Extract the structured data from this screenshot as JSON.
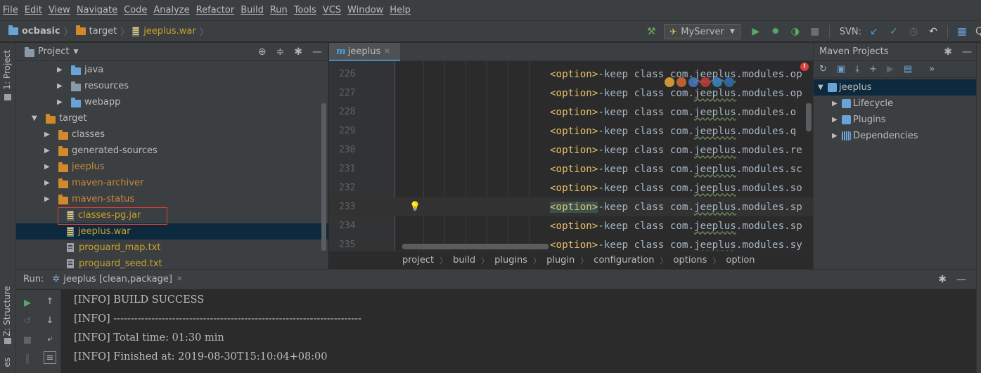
{
  "menu": [
    "File",
    "Edit",
    "View",
    "Navigate",
    "Code",
    "Analyze",
    "Refactor",
    "Build",
    "Run",
    "Tools",
    "VCS",
    "Window",
    "Help"
  ],
  "nav_breadcrumbs": [
    "ocbasic",
    "target",
    "jeeplus.war"
  ],
  "toolbar": {
    "run_config": "MyServer",
    "svn_label": "SVN:"
  },
  "left_tabs": {
    "project": "1: Project",
    "structure": "Z: Structure",
    "favorites": "es"
  },
  "project_panel": {
    "title": "Project",
    "tree": [
      {
        "label": "java",
        "arrow": "▶",
        "icon": "folder-blue",
        "color": "plain"
      },
      {
        "label": "resources",
        "arrow": "▶",
        "icon": "folder-gray",
        "color": "plain"
      },
      {
        "label": "webapp",
        "arrow": "▶",
        "icon": "folder-blue",
        "color": "plain"
      },
      {
        "label": "target",
        "arrow": "▼",
        "icon": "folder-orange",
        "color": "plain"
      },
      {
        "label": "classes",
        "arrow": "▶",
        "icon": "folder-orange",
        "color": "plain"
      },
      {
        "label": "generated-sources",
        "arrow": "▶",
        "icon": "folder-orange",
        "color": "plain"
      },
      {
        "label": "jeeplus",
        "arrow": "▶",
        "icon": "folder-orange",
        "color": "orange"
      },
      {
        "label": "maven-archiver",
        "arrow": "▶",
        "icon": "folder-orange",
        "color": "orange"
      },
      {
        "label": "maven-status",
        "arrow": "▶",
        "icon": "folder-orange",
        "color": "orange"
      },
      {
        "label": "classes-pg.jar",
        "arrow": "",
        "icon": "archive",
        "color": "yellow"
      },
      {
        "label": "jeeplus.war",
        "arrow": "",
        "icon": "archive",
        "color": "yellow"
      },
      {
        "label": "proguard_map.txt",
        "arrow": "",
        "icon": "text-file",
        "color": "yellow"
      },
      {
        "label": "proguard_seed.txt",
        "arrow": "",
        "icon": "text-file",
        "color": "yellow"
      }
    ]
  },
  "editor": {
    "tab_label": "jeeplus",
    "lines": [
      {
        "no": "226",
        "tag": "<option>",
        "text": "-keep class com.",
        "pkg": "jeeplus",
        "rest": ".modules.op"
      },
      {
        "no": "227",
        "tag": "<option>",
        "text": "-keep class com.",
        "pkg": "jeeplus",
        "rest": ".modules.op"
      },
      {
        "no": "228",
        "tag": "<option>",
        "text": "-keep class com.",
        "pkg": "jeeplus",
        "rest": ".modules.o"
      },
      {
        "no": "229",
        "tag": "<option>",
        "text": "-keep class com.",
        "pkg": "jeeplus",
        "rest": ".modules.q"
      },
      {
        "no": "230",
        "tag": "<option>",
        "text": "-keep class com.",
        "pkg": "jeeplus",
        "rest": ".modules.re"
      },
      {
        "no": "231",
        "tag": "<option>",
        "text": "-keep class com.",
        "pkg": "jeeplus",
        "rest": ".modules.sc"
      },
      {
        "no": "232",
        "tag": "<option>",
        "text": "-keep class com.",
        "pkg": "jeeplus",
        "rest": ".modules.so"
      },
      {
        "no": "233",
        "tag": "<option>",
        "text": "-keep class com.",
        "pkg": "jeeplus",
        "rest": ".modules.sp"
      },
      {
        "no": "234",
        "tag": "<option>",
        "text": "-keep class com.",
        "pkg": "jeeplus",
        "rest": ".modules.sp"
      },
      {
        "no": "235",
        "tag": "<option>",
        "text": "-keep class com.",
        "pkg": "jeeplus",
        "rest": ".modules.sy"
      }
    ],
    "breadcrumb": [
      "project",
      "build",
      "plugins",
      "plugin",
      "configuration",
      "options",
      "option"
    ]
  },
  "maven": {
    "title": "Maven Projects",
    "tree": [
      {
        "label": "jeeplus",
        "arrow": "▼",
        "indent": 0
      },
      {
        "label": "Lifecycle",
        "arrow": "▶",
        "indent": 1
      },
      {
        "label": "Plugins",
        "arrow": "▶",
        "indent": 1
      },
      {
        "label": "Dependencies",
        "arrow": "▶",
        "indent": 1
      }
    ]
  },
  "run_panel": {
    "label": "Run:",
    "tab": "jeeplus [clean,package]",
    "console": [
      "[INFO] BUILD SUCCESS",
      "[INFO] ------------------------------------------------------------------------",
      "[INFO] Total time: 01:30 min",
      "[INFO] Finished at: 2019-08-30T15:10:04+08:00"
    ]
  },
  "colors": {
    "accent": "#4a88c7",
    "highlight_border": "#d6403a",
    "selection": "#0d293e",
    "xml_tag": "#e8bf6a"
  },
  "icons": {
    "hammer": "build-icon",
    "run": "run-icon",
    "debug": "debug-icon",
    "coverage": "coverage-icon",
    "stop": "stop-icon",
    "svn_update": "svn-update-icon",
    "svn_commit": "svn-commit-icon",
    "svn_history": "history-icon",
    "revert": "revert-icon"
  }
}
